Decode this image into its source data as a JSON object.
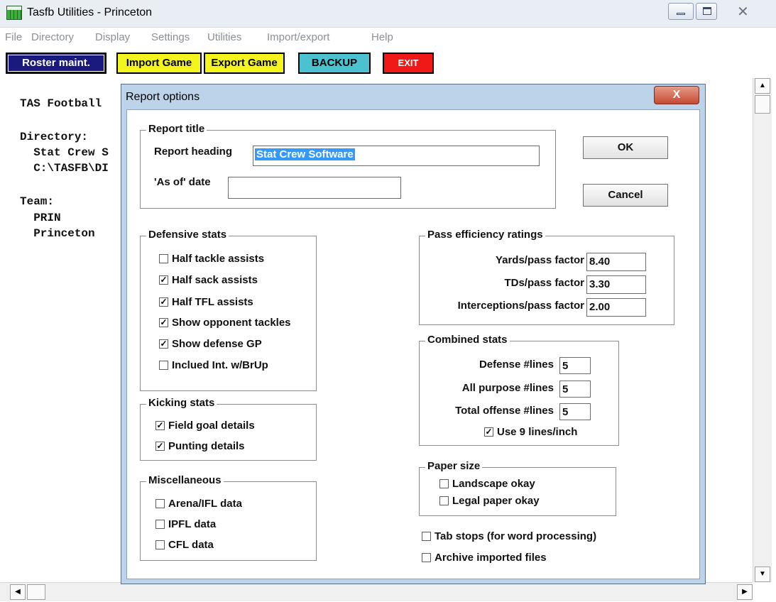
{
  "window": {
    "title": "Tasfb Utilities - Princeton"
  },
  "menu": [
    "File",
    "Directory",
    "Display",
    "Settings",
    "Utilities",
    "Import/export",
    "Help"
  ],
  "toolbar": {
    "roster": "Roster maint.",
    "import": "Import Game",
    "export": "Export Game",
    "backup": "BACKUP",
    "exit": "EXIT"
  },
  "background": {
    "line1": "TAS Football",
    "line2": "Directory:",
    "line3": "  Stat Crew S",
    "line4": "  C:\\TASFB\\DI",
    "line5": "Team:",
    "line6": "  PRIN",
    "line7": "  Princeton"
  },
  "dialog": {
    "title": "Report options",
    "close_glyph": "X",
    "ok": "OK",
    "cancel": "Cancel",
    "report_title": {
      "group": "Report title",
      "heading_label": "Report heading",
      "heading_value": "Stat Crew Software",
      "asof_label": "'As of' date",
      "asof_value": ""
    },
    "defensive": {
      "group": "Defensive stats",
      "items": [
        {
          "label": "Half tackle assists",
          "checked": false
        },
        {
          "label": "Half sack assists",
          "checked": true
        },
        {
          "label": "Half TFL assists",
          "checked": true
        },
        {
          "label": "Show opponent tackles",
          "checked": true
        },
        {
          "label": "Show defense GP",
          "checked": true
        },
        {
          "label": "Inclued Int. w/BrUp",
          "checked": false
        }
      ]
    },
    "kicking": {
      "group": "Kicking stats",
      "items": [
        {
          "label": "Field goal details",
          "checked": true
        },
        {
          "label": "Punting details",
          "checked": true
        }
      ]
    },
    "misc": {
      "group": "Miscellaneous",
      "items": [
        {
          "label": "Arena/IFL data",
          "checked": false
        },
        {
          "label": "IPFL data",
          "checked": false
        },
        {
          "label": "CFL data",
          "checked": false
        }
      ]
    },
    "pass_eff": {
      "group": "Pass efficiency ratings",
      "yards_label": "Yards/pass factor",
      "yards_value": "8.40",
      "tds_label": "TDs/pass factor",
      "tds_value": "3.30",
      "int_label": "Interceptions/pass factor",
      "int_value": "2.00"
    },
    "combined": {
      "group": "Combined stats",
      "def_label": "Defense #lines",
      "def_value": "5",
      "ap_label": "All purpose #lines",
      "ap_value": "5",
      "to_label": "Total offense #lines",
      "to_value": "5",
      "nine_label": "Use 9 lines/inch",
      "nine_checked": true
    },
    "paper": {
      "group": "Paper size",
      "items": [
        {
          "label": "Landscape okay",
          "checked": false
        },
        {
          "label": "Legal paper okay",
          "checked": false
        }
      ]
    },
    "tab_stops": {
      "label": "Tab stops (for word processing)",
      "checked": false
    },
    "archive": {
      "label": "Archive imported files",
      "checked": false
    }
  },
  "colors": {
    "roster_bg": "#1a1a7e",
    "import_bg": "#f4f51f",
    "backup_bg": "#4cc2d0",
    "exit_bg": "#f11818",
    "dialog_frame": "#bcd3ea",
    "selection": "#3399ff"
  }
}
